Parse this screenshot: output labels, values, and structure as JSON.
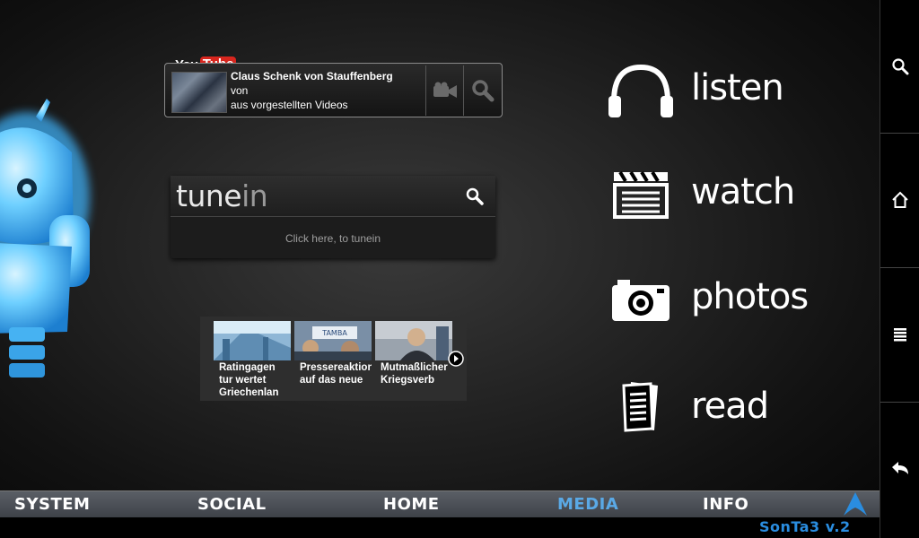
{
  "youtube": {
    "logo_you": "You",
    "logo_tube": "Tube",
    "title": "Claus Schenk von Stauffenberg",
    "line2": "von",
    "line3": "aus vorgestellten Videos"
  },
  "tunein": {
    "logo_tune": "tune",
    "logo_in": "in",
    "link_text": "Click here, to tunein"
  },
  "news": {
    "items": [
      {
        "text": "Ratingagen tur wertet Griechenlan"
      },
      {
        "text": "Pressereaktionen auf das neue"
      },
      {
        "text": "Mutmaßlicher Kriegsverb"
      }
    ]
  },
  "menu": {
    "listen": "listen",
    "watch": "watch",
    "photos": "photos",
    "read": "read"
  },
  "bottom_bar": {
    "system": "SYSTEM",
    "social": "SOCIAL",
    "home": "HOME",
    "media": "MEDIA",
    "info": "INFO",
    "version": "SonTa3 v.2"
  },
  "colors": {
    "active_tab": "#5aa9e6",
    "version": "#2a8de0",
    "youtube_red": "#d8261e"
  },
  "sysbar": {
    "icons": [
      "search-icon",
      "home-icon",
      "menu-icon",
      "back-icon"
    ]
  }
}
